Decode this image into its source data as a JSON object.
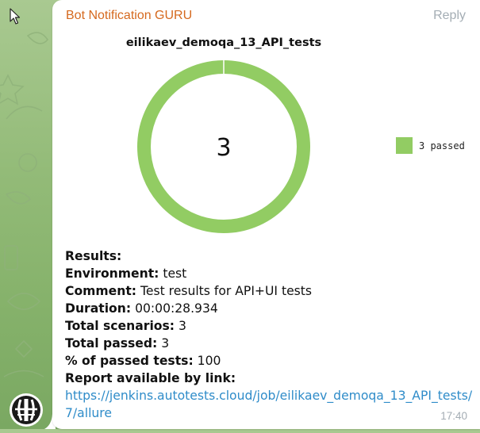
{
  "message": {
    "sender": "Bot Notification GURU",
    "reply_label": "Reply",
    "time": "17:40",
    "lines": [
      {
        "label": "Results:",
        "value": ""
      },
      {
        "label": "Environment:",
        "value": " test"
      },
      {
        "label": "Comment:",
        "value": " Test results for API+UI tests"
      },
      {
        "label": "Duration:",
        "value": " 00:00:28.934"
      },
      {
        "label": "Total scenarios:",
        "value": " 3"
      },
      {
        "label": "Total passed:",
        "value": " 3"
      },
      {
        "label": "% of passed tests:",
        "value": " 100"
      },
      {
        "label": "Report available by link:",
        "value": ""
      }
    ],
    "link_line1": "https://jenkins.autotests.cloud/job/eilikaev_demoqa_13_API_tests/",
    "link_line2": "7/allure"
  },
  "colors": {
    "passed": "#92cc63",
    "sender": "#d5691e",
    "link": "#2f8cc9"
  },
  "chart_data": {
    "type": "pie",
    "title": "eilikaev_demoqa_13_API_tests",
    "center_label": "3",
    "categories": [
      "3 passed"
    ],
    "values": [
      3
    ],
    "legend_position": "right"
  }
}
